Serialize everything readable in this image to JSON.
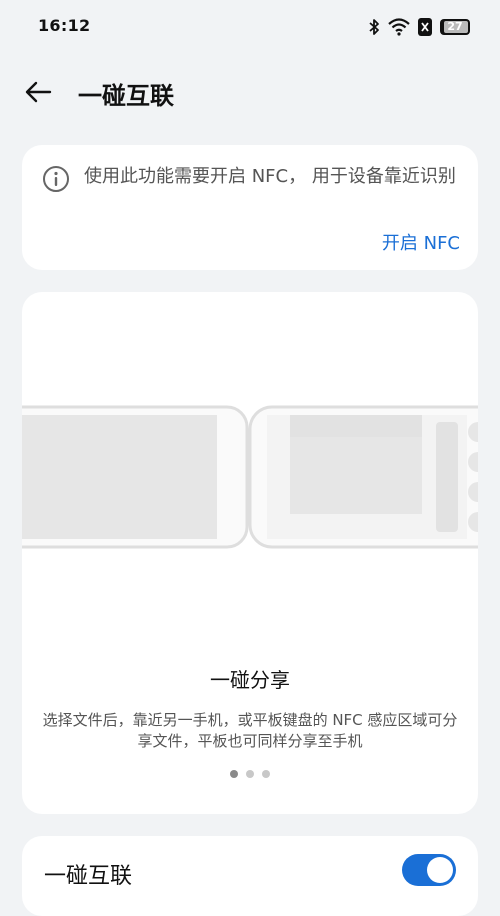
{
  "status_bar": {
    "time": "16:12",
    "battery_level": "27"
  },
  "header": {
    "title": "一碰互联"
  },
  "notice": {
    "message": "使用此功能需要开启 NFC， 用于设备靠近识别",
    "action_label": "开启 NFC"
  },
  "feature": {
    "title": "一碰分享",
    "description": "选择文件后，靠近另一手机，或平板键盘的 NFC 感应区域可分享文件，平板也可同样分享至手机",
    "pages": 3,
    "active_page": 1
  },
  "toggle_row": {
    "label": "一碰互联",
    "enabled": true
  },
  "colors": {
    "accent": "#1a6fd6",
    "background": "#f1f3f5"
  },
  "icons": [
    "bluetooth-icon",
    "wifi-icon",
    "sim-icon",
    "battery-icon",
    "back-arrow-icon",
    "info-icon"
  ]
}
